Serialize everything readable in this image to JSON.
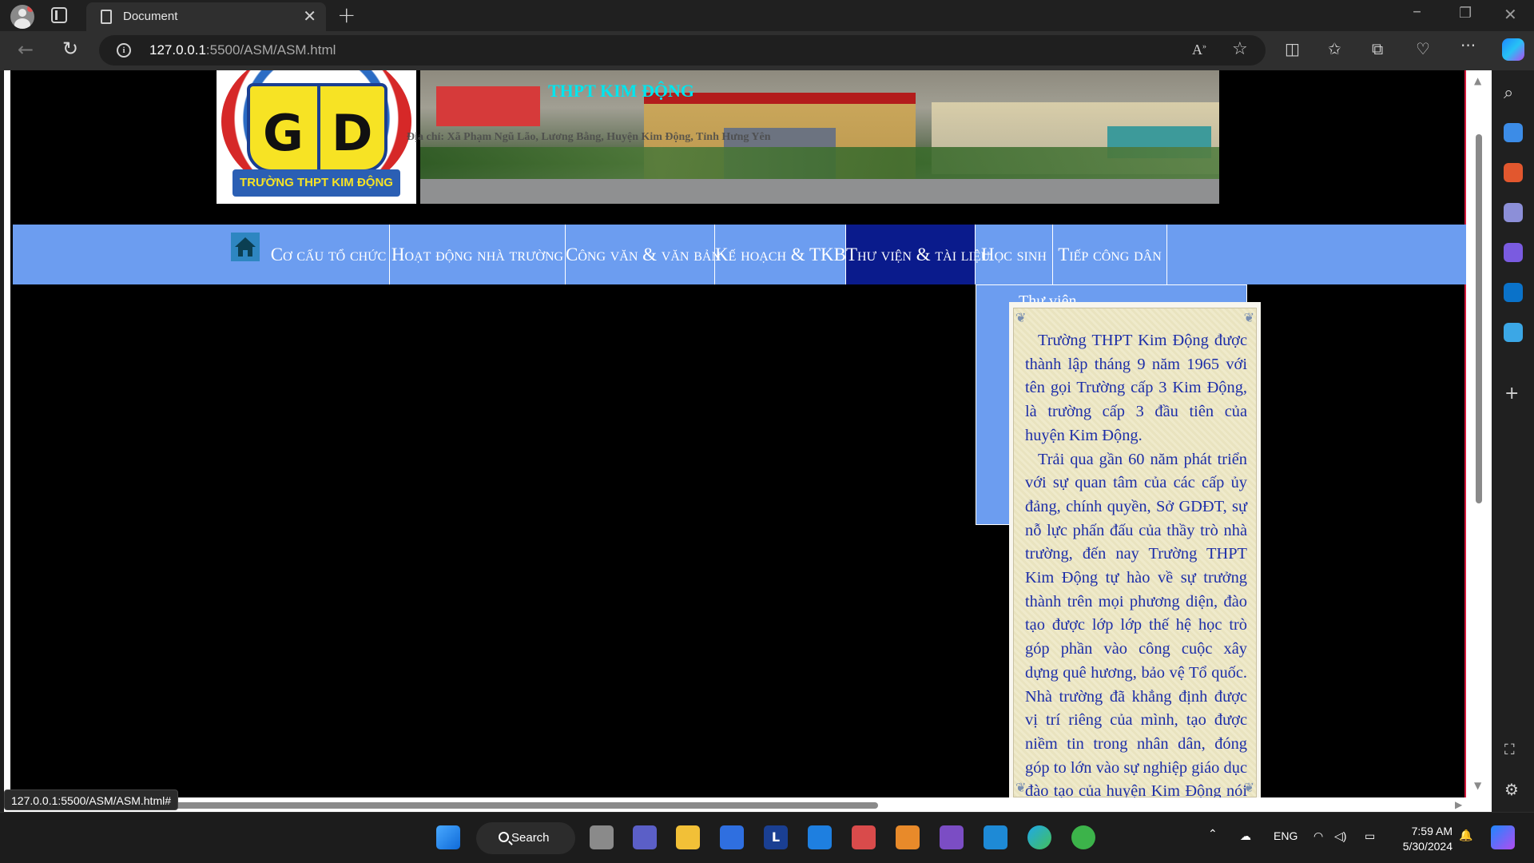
{
  "browser": {
    "tab_title": "Document",
    "tab_close": "✕",
    "new_tab": "+",
    "url_host": "127.0.0.1",
    "url_path": ":5500/ASM/ASM.html",
    "status_url": "127.0.0.1:5500/ASM/ASM.html#"
  },
  "header": {
    "logo_letter_left": "G",
    "logo_letter_right": "D",
    "logo_text": "TRƯỜNG THPT KIM ĐỘNG",
    "school_name": "THPT KIM ĐỘNG",
    "address": "Địa chỉ: Xã Phạm Ngũ Lão, Lương Bằng, Huyện Kim Động, Tỉnh Hưng Yên"
  },
  "menu": {
    "items": [
      {
        "label": "Cơ cấu tổ chức"
      },
      {
        "label": "Hoạt động nhà trường"
      },
      {
        "label": "Công văn & văn bản"
      },
      {
        "label": "Kế hoạch & TKB"
      },
      {
        "label": "Thư viện & tài liệu"
      },
      {
        "label": "Học sinh"
      },
      {
        "label": "Tiếp công dân"
      }
    ],
    "active_index": 4,
    "dropdown_peek": "Thư viện"
  },
  "intro": {
    "paragraph1": "Trường THPT Kim Động được thành lập tháng 9 năm 1965 với tên gọi Trường cấp 3 Kim Động, là trường cấp 3 đầu tiên của huyện Kim Động.",
    "paragraph2": "Trải qua gần 60 năm phát triển với sự quan tâm của các cấp ủy đảng, chính quyền, Sở GDĐT, sự nỗ lực phấn đấu của thầy trò nhà trường, đến nay Trường THPT Kim Động tự hào về sự trưởng thành trên mọi phương diện, đào tạo được lớp lớp thế hệ học trò góp phần vào công cuộc xây dựng quê hương, bảo vệ Tổ quốc. Nhà trường đã khẳng định được vị trí riêng của mình, tạo được niềm tin trong nhân dân, đóng góp to lớn vào sự nghiệp giáo dục đào tạo của huyện Kim Động nói riêng và tỉnh Hưng Yên nói chung."
  },
  "taskbar": {
    "search_label": "Search",
    "language": "ENG",
    "time": "7:59 AM",
    "date": "5/30/2024"
  },
  "colors": {
    "menu_bg": "#6c9df0",
    "menu_active": "#0a1b8c",
    "school_name": "#00e5ee",
    "intro_text": "#1d2ea8"
  }
}
